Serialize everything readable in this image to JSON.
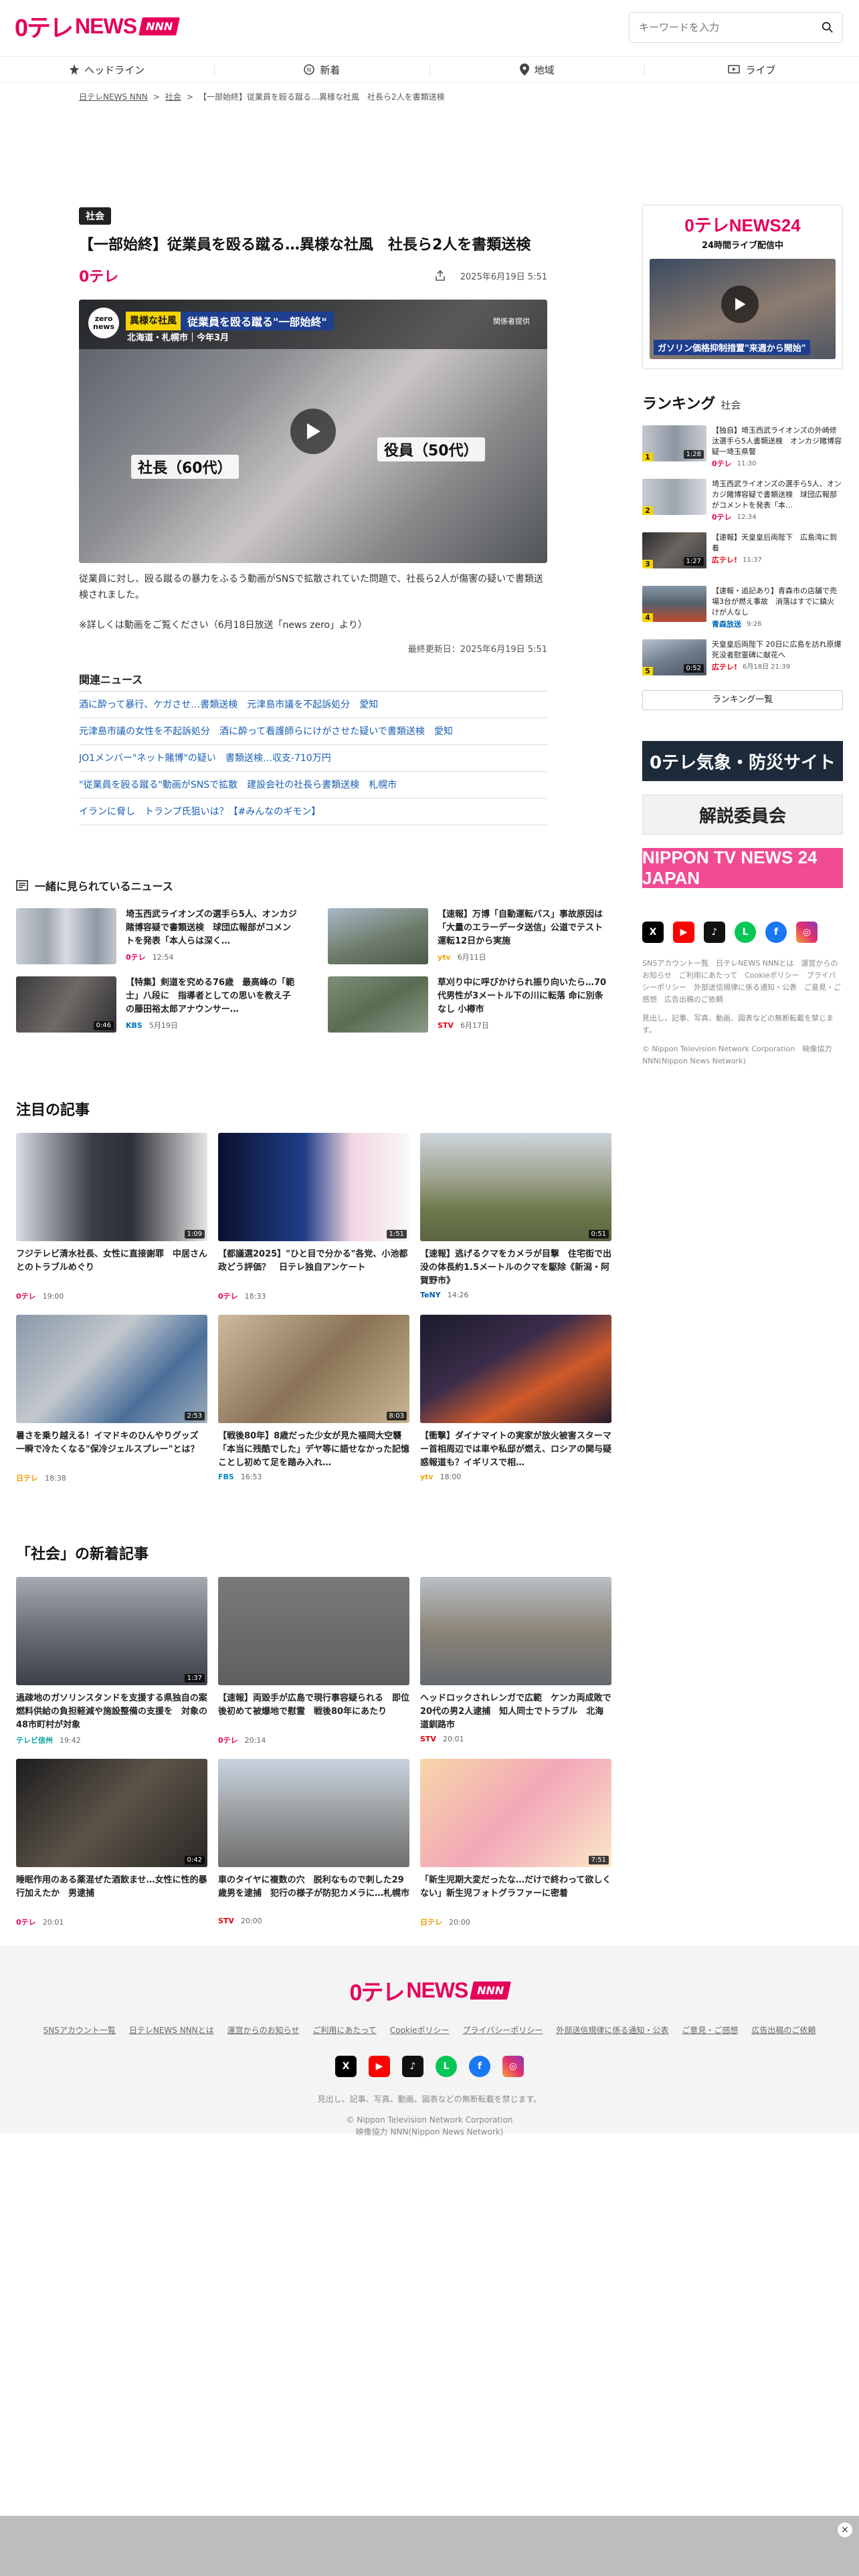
{
  "header": {
    "logo_mark": "0テレ",
    "logo_text": "NEWS",
    "logo_badge": "NNN",
    "search_placeholder": "キーワードを入力"
  },
  "nav": [
    {
      "label": "ヘッドライン",
      "icon": "headline-icon"
    },
    {
      "label": "新着",
      "icon": "new-icon"
    },
    {
      "label": "地域",
      "icon": "map-pin-icon"
    },
    {
      "label": "ライブ",
      "icon": "live-icon"
    }
  ],
  "breadcrumb": [
    "日テレNEWS NNN",
    "社会",
    "【一部始終】従業員を殴る蹴る…異様な社風　社長ら2人を書類送検"
  ],
  "article": {
    "category": "社会",
    "title": "【一部始終】従業員を殴る蹴る…異様な社風　社長ら2人を書類送検",
    "source_mark": "0テレ",
    "date": "2025年6月19日 5:51",
    "video": {
      "zero_badge": "zero news",
      "tag": "異様な社風",
      "headline": "従業員を殴る蹴る\"一部始終\"",
      "location": "北海道・札幌市｜今年3月",
      "source": "関係者提供",
      "label_left": "社長（60代）",
      "label_right": "役員（50代）"
    },
    "lead": "従業員に対し、殴る蹴るの暴力をふるう動画がSNSで拡散されていた問題で、社長ら2人が傷害の疑いで書類送検されました。",
    "note": "※詳しくは動画をご覧ください（6月18日放送「news zero」より）",
    "updated": "最終更新日：2025年6月19日 5:51",
    "related_title": "関連ニュース",
    "related": [
      "酒に酔って暴行、ケガさせ…書類送検　元津島市議を不起訴処分　愛知",
      "元津島市議の女性を不起訴処分　酒に酔って看護師らにけがさせた疑いで書類送検　愛知",
      "JO1メンバー\"ネット賭博\"の疑い　書類送検…収支-710万円",
      "\"従業員を殴る蹴る\"動画がSNSで拡散　建設会社の社長ら書類送検　札幌市",
      "イランに脅し　トランプ氏狙いは？【#みんなのギモン】"
    ]
  },
  "also_viewed": {
    "title": "一緒に見られているニュース",
    "items": [
      {
        "title": "埼玉西武ライオンズの選手ら5人、オンカジ賭博容疑で書類送検　球団広報部がコメントを発表「本人らは深く…",
        "src": "0テレ",
        "time": "12:54",
        "dur": ""
      },
      {
        "title": "【速報】万博「自動運転バス」事故原因は「大量のエラーデータ送信」公道でテスト運転12日から実施",
        "src": "ytv",
        "time": "6月11日",
        "dur": ""
      },
      {
        "title": "【特集】剣道を究める76歳　最高峰の「範士」八段に　指導者としての思いを教え子の藤田裕太郎アナウンサー…",
        "src": "KBS",
        "time": "5月19日",
        "dur": "0:46"
      },
      {
        "title": "草刈り中に呼びかけられ振り向いたら…70代男性が3メートル下の川に転落 命に別条なし 小樽市",
        "src": "STV",
        "time": "6月17日",
        "dur": ""
      }
    ]
  },
  "featured": {
    "title": "注目の記事",
    "items": [
      {
        "title": "フジテレビ清水社長、女性に直接謝罪　中居さんとのトラブルめぐり",
        "src": "0テレ",
        "time": "19:00",
        "dur": "1:09"
      },
      {
        "title": "【都議選2025】\"ひと目で分かる\"各党、小池都政どう評価？　日テレ独自アンケート",
        "src": "0テレ",
        "time": "18:33",
        "dur": "1:51"
      },
      {
        "title": "【速報】逃げるクマをカメラが目撃　住宅街で出没の体長約1.5メートルのクマを駆除《新潟・阿賀野市》",
        "src": "TeNY",
        "time": "14:26",
        "dur": "0:51"
      },
      {
        "title": "暑さを乗り越える！イマドキのひんやりグッズ　一瞬で冷たくなる\"保冷ジェルスプレー\"とは？",
        "src": "日テレ",
        "time": "18:38",
        "dur": "2:53"
      },
      {
        "title": "【戦後80年】8歳だった少女が見た福岡大空襲「本当に残酷でした」デヤ等に語せなかった記憶　ことし初めて足を踏み入れ…",
        "src": "FBS",
        "time": "16:53",
        "dur": "8:03"
      },
      {
        "title": "【衝撃】ダイナマイトの実家が放火被害スターマー首相周辺では車や私邸が燃え、ロシアの関与疑惑報道も？イギリスで相…",
        "src": "ytv",
        "time": "18:00",
        "dur": ""
      }
    ]
  },
  "society": {
    "title": "「社会」の新着記事",
    "items": [
      {
        "title": "過疎地のガソリンスタンドを支援する県独自の案　燃料供給の負担軽減や施設整備の支援を　対象の48市町村が対象",
        "src": "テレビ信州",
        "time": "19:42",
        "dur": "1:37"
      },
      {
        "title": "【速報】両毀手が広島で現行事容疑られる　即位後初めて被爆地で慰霊　戦後80年にあたり",
        "src": "0テレ",
        "time": "20:14",
        "dur": ""
      },
      {
        "title": "ヘッドロックされレンガで広範　ケンカ両成敗で20代の男2人逮捕　知人同士でトラブル　北海道釧路市",
        "src": "STV",
        "time": "20:01",
        "dur": ""
      },
      {
        "title": "睡眠作用のある薬混ぜた酒飲ませ…女性に性的暴行加えたか　男逮捕",
        "src": "0テレ",
        "time": "20:01",
        "dur": "0:42"
      },
      {
        "title": "車のタイヤに複数の穴　脱利なもので刺した29歳男を逮捕　犯行の様子が防犯カメラに…札幌市",
        "src": "STV",
        "time": "20:00",
        "dur": ""
      },
      {
        "title": "「新生児期大変だったな…だけで終わって欲しくない」新生児フォトグラファーに密着",
        "src": "日テレ",
        "time": "20:00",
        "dur": "7:51"
      }
    ]
  },
  "sidebar": {
    "live_logo": "0テレNEWS24",
    "live_sub": "24時間ライブ配信中",
    "live_caption": "ガソリン価格抑制措置\"来週から開始\"",
    "ranking_title": "ランキング",
    "ranking_cat": "社会",
    "ranking": [
      {
        "rank": "1",
        "title": "【独自】埼玉西武ライオンズの外崎修汰選手ら5人書類送検　オンカジ賭博容疑一埼玉県警",
        "src": "0テレ",
        "time": "11:30",
        "dur": "1:28"
      },
      {
        "title": "埼玉西武ライオンズの選手ら5人、オンカジ賭博容疑で書類送検　球団広報部がコメントを発表「本…",
        "rank": "2",
        "src": "0テレ",
        "time": "12:34",
        "dur": ""
      },
      {
        "title": "【速報】天皇皇后両陛下　広島湾に到着",
        "rank": "3",
        "src": "広テレ!",
        "time": "11:37",
        "dur": "1:27"
      },
      {
        "title": "【速報・追記あり】青森市の店舗で売場3台が燃え事故　消落はすでに鎮火　けが人なし",
        "rank": "4",
        "src": "青森放送",
        "time": "9:26",
        "dur": ""
      },
      {
        "title": "天皇皇后両陛下 20日に広島を訪れ原爆死没者慰霊碑に献花へ",
        "rank": "5",
        "src": "広テレ!",
        "time": "6月18日 21:39",
        "dur": "0:52"
      }
    ],
    "ranking_more": "ランキング一覧",
    "banners": [
      "0テレ気象・防災サイト",
      "解説委員会",
      "NIPPON TV NEWS 24 JAPAN"
    ],
    "links": "SNSアカウント一覧　日テレNEWS NNNとは　運営からのお知らせ　ご利用にあたって　Cookieポリシー　プライバシーポリシー　外部送信規律に係る通知・公表　ご意見・ご感想　広告出稿のご依頼",
    "notice": "見出し、記事、写真、動画、図表などの無断転載を禁じます。",
    "copyright": "© Nippon Television Network Corporation　映像協力 NNN(Nippon News Network)"
  },
  "footer": {
    "links": [
      "SNSアカウント一覧",
      "日テレNEWS NNNとは",
      "運営からのお知らせ",
      "ご利用にあたって",
      "Cookieポリシー",
      "プライバシーポリシー",
      "外部送信規律に係る通知・公表",
      "ご意見・ご感想",
      "広告出稿のご依頼"
    ],
    "notice": "見出し、記事、写真、動画、図表などの無断転載を禁じます。",
    "copyright": "© Nippon Television Network Corporation",
    "credit": "映像協力 NNN(Nippon News Network)"
  },
  "colors": {
    "brand": "#e5005a",
    "link": "#1a5fb4",
    "text": "#222222"
  }
}
